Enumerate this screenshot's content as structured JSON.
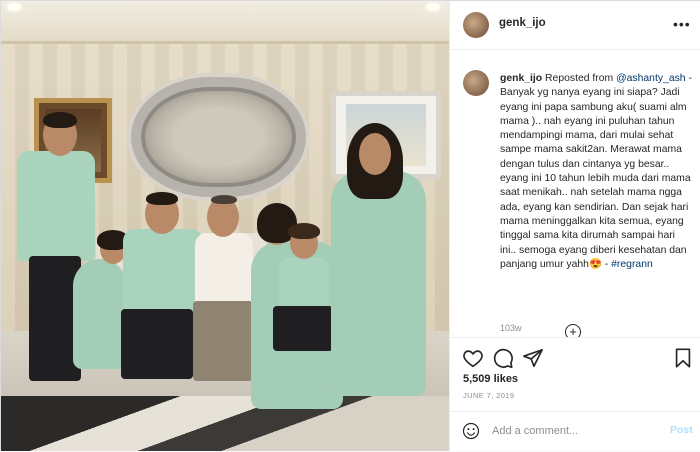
{
  "post": {
    "username": "genk_ijo",
    "caption": {
      "username": "genk_ijo",
      "reposted_prefix": "Reposted from",
      "mention": "@ashanty_ash",
      "text": "- Banyak yg nanya eyang ini siapa? Jadi eyang ini papa sambung aku( suami alm mama ).. nah eyang ini puluhan tahun mendampingi mama, dari mulai sehat sampe mama sakit2an. Merawat mama dengan tulus dan cintanya yg besar.. eyang ini 10 tahun lebih muda dari mama saat menikah.. nah setelah mama ngga ada, eyang kan sendirian. Dan sejak hari mama meninggalkan kita semua, eyang tinggal sama kita dirumah sampai hari ini.. semoga eyang diberi kesehatan dan panjang umur yahh",
      "emoji": "😍",
      "separator": " - ",
      "hashtag": "#regrann"
    },
    "age": "103w",
    "likes": "5,509 likes",
    "date": "JUNE 7, 2019"
  },
  "comment": {
    "placeholder": "Add a comment...",
    "post_label": "Post"
  },
  "icons": {
    "more": "more-horizontal-icon",
    "like": "heart-icon",
    "comment": "comment-bubble-icon",
    "share": "paper-plane-icon",
    "save": "bookmark-icon",
    "emoji": "smiley-icon",
    "load_more": "plus-circle-icon"
  },
  "colors": {
    "link": "#00376b",
    "muted": "#8e8e8e",
    "post_button": "#b2dffc",
    "border": "#dbdbdb"
  }
}
